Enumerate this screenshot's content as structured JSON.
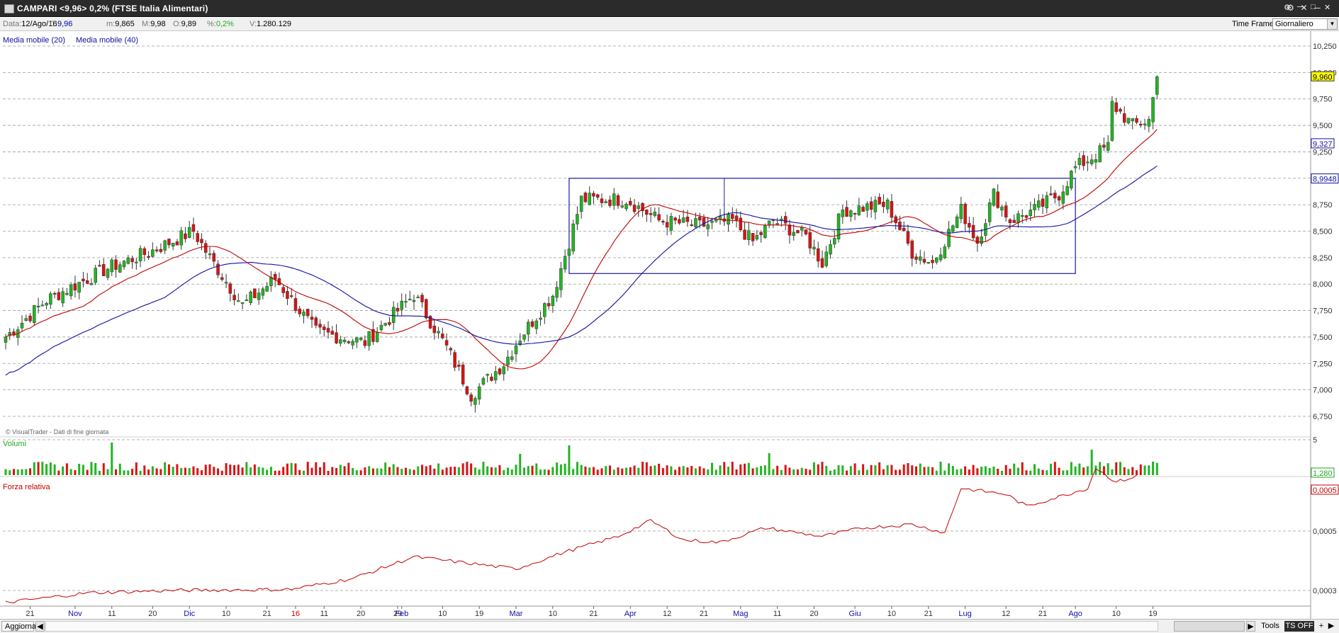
{
  "window": {
    "title": "CAMPARI <9,96> 0,2%  (FTSE Italia Alimentari)",
    "controls": {
      "tools_icon": "tools-icon",
      "close_small": "x"
    }
  },
  "infobar": {
    "date_label": "Data:",
    "date": "12/Ago/16",
    "close_label": "C:",
    "close": "9,96",
    "min_label": "m:",
    "min": "9,865",
    "max_label": "M:",
    "max": "9,98",
    "open_label": "O:",
    "open": "9,89",
    "pct_label": "%:",
    "pct": "0,2%",
    "vol_label": "V:",
    "vol": "1.280.129",
    "timeframe_label": "Time Frame",
    "timeframe_value": "Giornaliero"
  },
  "bottombar": {
    "refresh_label": "Aggiorna",
    "tools_label": "Tools",
    "tsoff_label": "TS OFF",
    "plus_label": "+"
  },
  "colors": {
    "up": "#22b522",
    "down": "#dd1111",
    "ma20": "#c00000",
    "ma40": "#1010a0",
    "box": "#1a1aa0",
    "rs": "#c00000",
    "price_tag_bg": "#ffff00"
  },
  "chart_data": [
    {
      "type": "candlestick",
      "title": "",
      "legend": [
        "Media mobile (20)",
        "Media mobile (40)"
      ],
      "copyright": "© VisualTrader - Dati di fine giornata",
      "ylim": [
        6.7,
        10.3
      ],
      "yticks": [
        6.75,
        7.0,
        7.25,
        7.5,
        7.75,
        8.0,
        8.25,
        8.5,
        8.75,
        9.0,
        9.25,
        9.5,
        9.75,
        10.0,
        10.25
      ],
      "ytick_labels": [
        "6,750",
        "7,000",
        "7,250",
        "7,500",
        "7,750",
        "8,000",
        "8,250",
        "8,500",
        "8,750",
        "9,000",
        "9,250",
        "9,500",
        "9,750",
        "10,000",
        "10,250"
      ],
      "price_tags": {
        "last": "9,960",
        "last_value": 9.96,
        "ma20": "9,327",
        "ma20_value": 9.327,
        "ma40": "8,9948",
        "ma40_value": 8.9948
      },
      "range_box": {
        "start_bar": 138,
        "end_bar": 262,
        "low": 8.1,
        "high": 9.0
      },
      "key_prices": [
        [
          0,
          7.5
        ],
        [
          10,
          7.85
        ],
        [
          25,
          8.15
        ],
        [
          35,
          8.3
        ],
        [
          46,
          8.5
        ],
        [
          50,
          8.25
        ],
        [
          58,
          7.8
        ],
        [
          66,
          8.05
        ],
        [
          76,
          7.55
        ],
        [
          88,
          7.45
        ],
        [
          100,
          7.9
        ],
        [
          108,
          7.4
        ],
        [
          114,
          6.95
        ],
        [
          122,
          7.25
        ],
        [
          126,
          7.5
        ],
        [
          134,
          7.9
        ],
        [
          138,
          8.4
        ],
        [
          141,
          8.8
        ],
        [
          152,
          8.8
        ],
        [
          160,
          8.6
        ],
        [
          170,
          8.55
        ],
        [
          178,
          8.6
        ],
        [
          183,
          8.4
        ],
        [
          188,
          8.6
        ],
        [
          196,
          8.45
        ],
        [
          200,
          8.2
        ],
        [
          205,
          8.7
        ],
        [
          216,
          8.75
        ],
        [
          222,
          8.3
        ],
        [
          227,
          8.2
        ],
        [
          234,
          8.7
        ],
        [
          238,
          8.4
        ],
        [
          242,
          8.85
        ],
        [
          246,
          8.6
        ],
        [
          252,
          8.7
        ],
        [
          258,
          8.85
        ],
        [
          262,
          9.1
        ],
        [
          266,
          9.2
        ],
        [
          270,
          9.3
        ],
        [
          271,
          9.7
        ],
        [
          276,
          9.5
        ],
        [
          280,
          9.55
        ],
        [
          282,
          9.96
        ]
      ],
      "x_tick_labels": [
        {
          "bar": 6,
          "label": "21"
        },
        {
          "bar": 17,
          "label": "Nov"
        },
        {
          "bar": 26,
          "label": "11"
        },
        {
          "bar": 36,
          "label": "20"
        },
        {
          "bar": 45,
          "label": "Dic"
        },
        {
          "bar": 54,
          "label": "10"
        },
        {
          "bar": 64,
          "label": "21"
        },
        {
          "bar": 71,
          "label": "16",
          "color": "#cc0000"
        },
        {
          "bar": 78,
          "label": "11"
        },
        {
          "bar": 87,
          "label": "20"
        },
        {
          "bar": 96,
          "label": "29"
        },
        {
          "bar": 97,
          "label": "Feb"
        },
        {
          "bar": 107,
          "label": "10"
        },
        {
          "bar": 116,
          "label": "19"
        },
        {
          "bar": 125,
          "label": "Mar"
        },
        {
          "bar": 134,
          "label": "10"
        },
        {
          "bar": 144,
          "label": "21"
        },
        {
          "bar": 153,
          "label": "Apr"
        },
        {
          "bar": 162,
          "label": "12"
        },
        {
          "bar": 171,
          "label": "21"
        },
        {
          "bar": 180,
          "label": "Mag"
        },
        {
          "bar": 189,
          "label": "11"
        },
        {
          "bar": 198,
          "label": "20"
        },
        {
          "bar": 208,
          "label": "Giu"
        },
        {
          "bar": 217,
          "label": "10"
        },
        {
          "bar": 226,
          "label": "21"
        },
        {
          "bar": 235,
          "label": "Lug"
        },
        {
          "bar": 245,
          "label": "12"
        },
        {
          "bar": 254,
          "label": "21"
        },
        {
          "bar": 262,
          "label": "Ago"
        },
        {
          "bar": 272,
          "label": "10"
        },
        {
          "bar": 281,
          "label": "19"
        }
      ]
    },
    {
      "type": "bar",
      "label": "Volumi",
      "ytick_labels": [
        "5"
      ],
      "last_value_tag": "1,280",
      "last_value": 1.28,
      "ylim": [
        0,
        5
      ],
      "spikes": [
        {
          "bar": 26,
          "value": 4.6
        },
        {
          "bar": 126,
          "value": 3.0
        },
        {
          "bar": 138,
          "value": 4.2
        },
        {
          "bar": 187,
          "value": 3.1
        },
        {
          "bar": 266,
          "value": 3.6
        },
        {
          "bar": 281,
          "value": 1.9
        }
      ]
    },
    {
      "type": "line",
      "label": "Forza relativa",
      "ytick_labels": [
        "0,0005",
        "0,0003"
      ],
      "last_value_tag": "0,0005",
      "key_values": [
        [
          0,
          0.0
        ],
        [
          20,
          0.08
        ],
        [
          40,
          0.1
        ],
        [
          70,
          0.11
        ],
        [
          85,
          0.2
        ],
        [
          100,
          0.38
        ],
        [
          110,
          0.34
        ],
        [
          125,
          0.28
        ],
        [
          137,
          0.42
        ],
        [
          150,
          0.55
        ],
        [
          158,
          0.68
        ],
        [
          166,
          0.52
        ],
        [
          175,
          0.5
        ],
        [
          186,
          0.62
        ],
        [
          200,
          0.55
        ],
        [
          210,
          0.62
        ],
        [
          222,
          0.65
        ],
        [
          230,
          0.58
        ],
        [
          234,
          0.95
        ],
        [
          245,
          0.9
        ],
        [
          250,
          0.8
        ],
        [
          258,
          0.88
        ],
        [
          265,
          0.95
        ],
        [
          267,
          1.12
        ],
        [
          272,
          1.0
        ],
        [
          277,
          1.05
        ]
      ]
    }
  ]
}
